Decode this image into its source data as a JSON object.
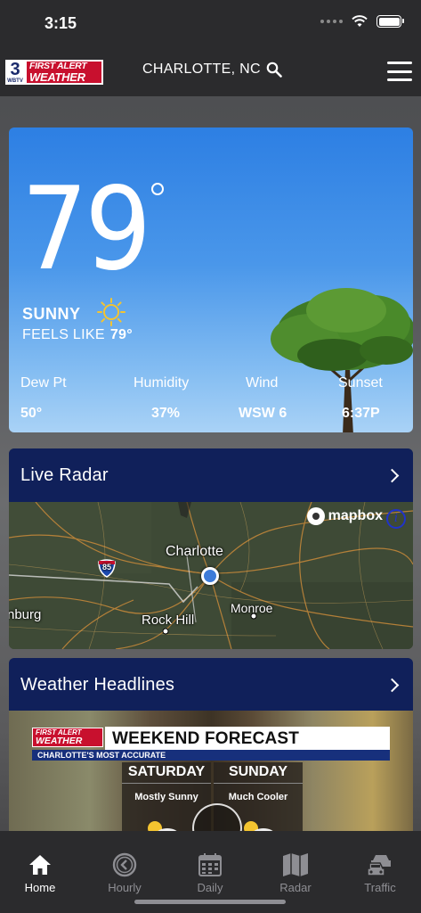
{
  "status_bar": {
    "time": "3:15"
  },
  "header": {
    "logo": {
      "channel": "3",
      "station": "WBTV",
      "line1": "FIRST ALERT",
      "line2": "WEATHER"
    },
    "location": "CHARLOTTE, NC"
  },
  "current": {
    "temperature": "79",
    "condition": "SUNNY",
    "feels_like_label": "FEELS LIKE",
    "feels_like_value": "79°",
    "stats": [
      {
        "label": "Dew Pt",
        "value": "50°"
      },
      {
        "label": "Humidity",
        "value": "37%"
      },
      {
        "label": "Wind",
        "value": "WSW 6"
      },
      {
        "label": "Sunset",
        "value": "6:37P"
      }
    ],
    "colors": {
      "sky_top": "#2d7fe3",
      "sky_bottom": "#a9d2f6"
    }
  },
  "radar": {
    "title": "Live Radar",
    "map_attribution": "mapbox",
    "labels": {
      "city": "Charlotte",
      "rock_hill": "Rock Hill",
      "monroe": "Monroe",
      "edge": "nburg",
      "interstate": "85"
    }
  },
  "headlines": {
    "title": "Weather Headlines",
    "video": {
      "logo_line1": "FIRST ALERT",
      "logo_line2": "WEATHER",
      "headline": "WEEKEND FORECAST",
      "subline": "CHARLOTTE'S MOST ACCURATE",
      "days": [
        {
          "name": "SATURDAY",
          "desc": "Mostly Sunny"
        },
        {
          "name": "SUNDAY",
          "desc": "Much Cooler"
        }
      ]
    }
  },
  "tabs": [
    {
      "label": "Home",
      "icon": "home-icon",
      "active": true
    },
    {
      "label": "Hourly",
      "icon": "clock-icon",
      "active": false
    },
    {
      "label": "Daily",
      "icon": "calendar-icon",
      "active": false
    },
    {
      "label": "Radar",
      "icon": "map-icon",
      "active": false
    },
    {
      "label": "Traffic",
      "icon": "car-icon",
      "active": false
    }
  ]
}
